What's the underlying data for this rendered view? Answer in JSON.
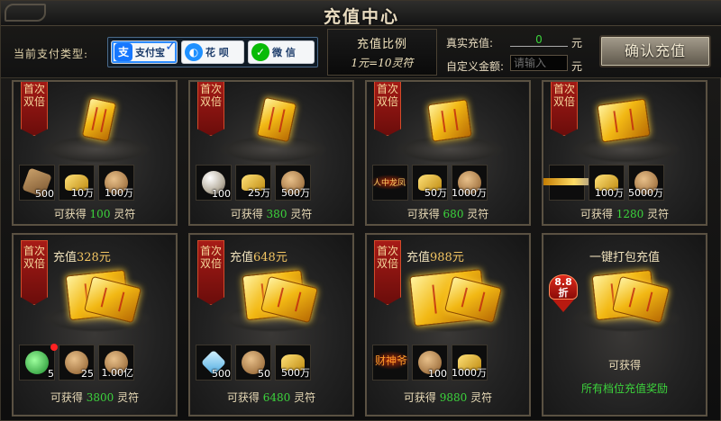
{
  "window": {
    "title": "充值中心"
  },
  "payment": {
    "label": "当前支付类型:",
    "options": [
      {
        "name": "支付宝",
        "icon": "alipay-icon",
        "selected": true,
        "color": "#1677ff"
      },
      {
        "name": "花 呗",
        "icon": "huabei-icon",
        "selected": false,
        "color": "#1e90ff"
      },
      {
        "name": "微 信",
        "icon": "wechat-icon",
        "selected": false,
        "color": "#09bb07"
      }
    ]
  },
  "rate": {
    "title": "充值比例",
    "value": "1元=10灵符"
  },
  "real_recharge": {
    "label": "真实充值:",
    "value": "0",
    "unit": "元"
  },
  "custom_amount": {
    "label": "自定义金额:",
    "placeholder": "请输入",
    "unit": "元"
  },
  "confirm_label": "确认充值",
  "gain_prefix": "可获得",
  "gain_suffix": "灵符",
  "ribbon_text": "首次双倍",
  "cards_row1": [
    {
      "items": [
        {
          "icon": "wood",
          "count": "500"
        },
        {
          "icon": "gold",
          "count": "10万"
        },
        {
          "icon": "bag",
          "count": "100万"
        }
      ],
      "gain": "100"
    },
    {
      "items": [
        {
          "icon": "pearl",
          "count": "100"
        },
        {
          "icon": "gold",
          "count": "25万"
        },
        {
          "icon": "bag",
          "count": "500万"
        }
      ],
      "gain": "380"
    },
    {
      "items": [
        {
          "icon": "empty",
          "count": "",
          "overlay": "人中龙凤"
        },
        {
          "icon": "gold",
          "count": "50万"
        },
        {
          "icon": "bag",
          "count": "1000万"
        }
      ],
      "gain": "680"
    },
    {
      "items": [
        {
          "icon": "empty",
          "count": ""
        },
        {
          "icon": "gold",
          "count": "100万"
        },
        {
          "icon": "bag",
          "count": "5000万"
        }
      ],
      "gain": "1280"
    }
  ],
  "cards_row2": [
    {
      "title_prefix": "充值",
      "amount": "328元",
      "items": [
        {
          "icon": "jade",
          "count": "5"
        },
        {
          "icon": "bag",
          "count": "25"
        },
        {
          "icon": "bag",
          "count": "1.00亿"
        }
      ],
      "gain": "3800"
    },
    {
      "title_prefix": "充值",
      "amount": "648元",
      "items": [
        {
          "icon": "crystal",
          "count": "500"
        },
        {
          "icon": "bag",
          "count": "50"
        },
        {
          "icon": "gold",
          "count": "500万"
        }
      ],
      "gain": "6480"
    },
    {
      "title_prefix": "充值",
      "amount": "988元",
      "items": [
        {
          "icon": "empty",
          "count": "",
          "overlay": "财神爷"
        },
        {
          "icon": "bag",
          "count": "100"
        },
        {
          "icon": "gold",
          "count": "1000万"
        }
      ],
      "gain": "9880"
    }
  ],
  "pack": {
    "title": "一键打包充值",
    "discount": "8.8折",
    "gain_line1": "可获得",
    "gain_line2": "所有档位充值奖励"
  }
}
